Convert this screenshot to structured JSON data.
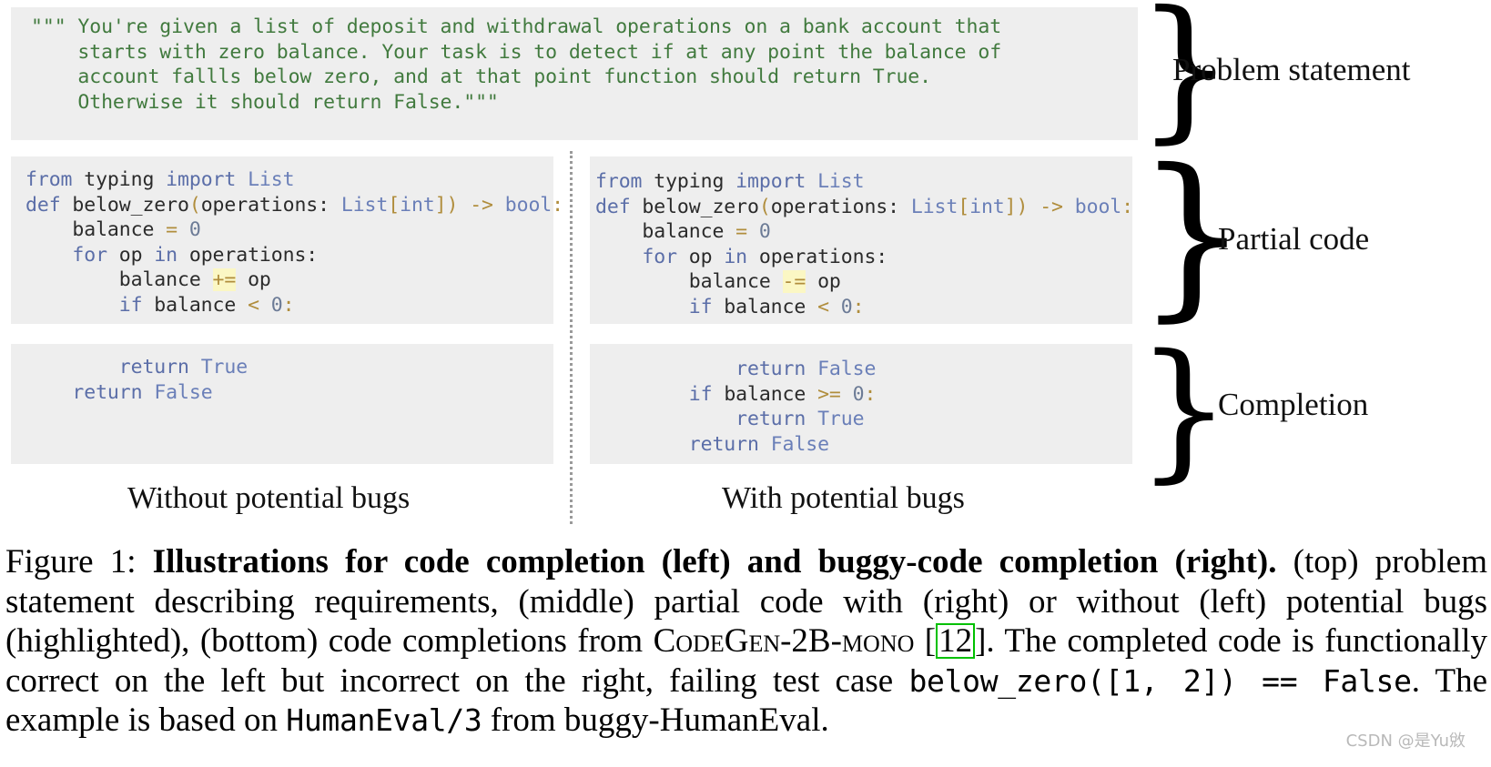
{
  "problem_statement": {
    "lines": [
      "\"\"\" You're given a list of deposit and withdrawal operations on a bank account that",
      "    starts with zero balance. Your task is to detect if at any point the balance of",
      "    account fallls below zero, and at that point function should return True.",
      "    Otherwise it should return False.\"\"\""
    ]
  },
  "partial_code": {
    "left": {
      "l1_kw_from": "from",
      "l1_mod": " typing ",
      "l1_kw_import": "import",
      "l1_cls": " List",
      "l2_kw_def": "def",
      "l2_name": " below_zero",
      "l2_paren_open": "(",
      "l2_args": "operations: ",
      "l2_cls": "List",
      "l2_brk_open": "[",
      "l2_int": "int",
      "l2_brk_close": "]",
      "l2_paren_close": ")",
      "l2_arrow": " -> ",
      "l2_ret": "bool",
      "l2_colon": ":",
      "l3": "    balance ",
      "l3_op": "=",
      "l3_num": " 0",
      "l4_kw_for": "    for",
      "l4_mid": " op ",
      "l4_kw_in": "in",
      "l4_end": " operations:",
      "l5_pre": "        balance ",
      "l5_hl": "+=",
      "l5_post": " op",
      "l6_kw_if": "        if",
      "l6_mid": " balance ",
      "l6_op": "<",
      "l6_num": " 0",
      "l6_colon": ":"
    },
    "right": {
      "l1_kw_from": "from",
      "l1_mod": " typing ",
      "l1_kw_import": "import",
      "l1_cls": " List",
      "l2_kw_def": "def",
      "l2_name": " below_zero",
      "l2_paren_open": "(",
      "l2_args": "operations: ",
      "l2_cls": "List",
      "l2_brk_open": "[",
      "l2_int": "int",
      "l2_brk_close": "]",
      "l2_paren_close": ")",
      "l2_arrow": " -> ",
      "l2_ret": "bool",
      "l2_colon": ":",
      "l3": "    balance ",
      "l3_op": "=",
      "l3_num": " 0",
      "l4_kw_for": "    for",
      "l4_mid": " op ",
      "l4_kw_in": "in",
      "l4_end": " operations:",
      "l5_pre": "        balance ",
      "l5_hl": "-=",
      "l5_post": " op",
      "l6_kw_if": "        if",
      "l6_mid": " balance ",
      "l6_op": "<",
      "l6_num": " 0",
      "l6_colon": ":"
    }
  },
  "completion": {
    "left": {
      "l1_indent": "        ",
      "l1_kw": "return",
      "l1_val": " True",
      "l2_indent": "    ",
      "l2_kw": "return",
      "l2_val": " False"
    },
    "right": {
      "l1_indent": "            ",
      "l1_kw": "return",
      "l1_val": " False",
      "l2_indent": "        ",
      "l2_kw": "if",
      "l2_mid": " balance ",
      "l2_op": ">=",
      "l2_num": " 0",
      "l2_colon": ":",
      "l3_indent": "            ",
      "l3_kw": "return",
      "l3_val": " True",
      "l4_indent": "        ",
      "l4_kw": "return",
      "l4_val": " False"
    }
  },
  "section_labels": {
    "problem_statement": "Problem statement",
    "partial_code": "Partial code",
    "completion": "Completion"
  },
  "column_captions": {
    "left": "Without potential bugs",
    "right": "With potential bugs"
  },
  "braces": {
    "glyph": "}"
  },
  "figure_caption": {
    "figure_number": "Figure 1:",
    "bold_title": "Illustrations for code completion (left) and buggy-code completion (right).",
    "body_1": " (top) problem statement describing requirements, (middle) partial code with (right) or without (left) potential bugs (highlighted), (bottom) code completions from ",
    "model_name": "CodeGen-2B-mono",
    "space_before_cite": " [",
    "citation": "12",
    "after_cite": "]. The completed code is functionally correct on the left but incorrect on the right, failing test case ",
    "test_case_1": "below_zero([1, 2])",
    "eq": " == ",
    "test_case_2": "False",
    "body_2": ". The example is based on ",
    "dataset_ref": "HumanEval/3",
    "body_3": " from buggy-HumanEval."
  },
  "watermark": {
    "text": "CSDN @是Yu敓"
  },
  "colors": {
    "code_background": "#eeeeee",
    "docstring_green": "#417a3e",
    "keyword_blue": "#5b6ea8",
    "operator_gold": "#b08d3c",
    "highlight_yellow": "#fbf7c4",
    "citation_box_green": "#00c000"
  }
}
